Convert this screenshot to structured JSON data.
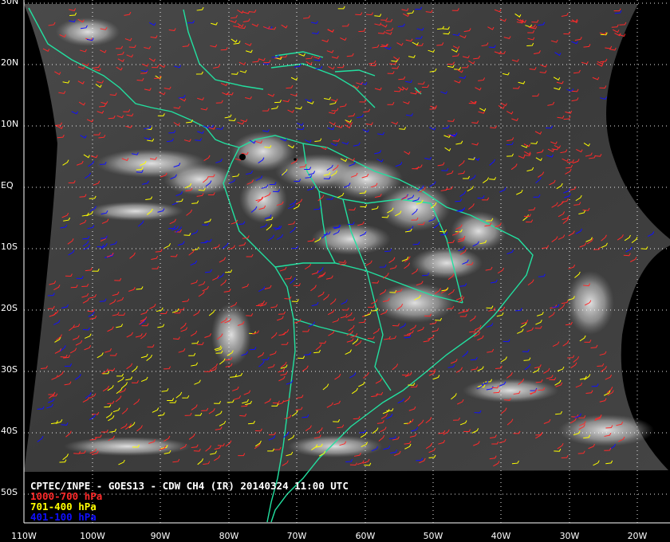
{
  "product_title": "CPTEC/INPE - GOES13 - CDW CH4 (IR) 20140324 11:00 UTC",
  "latitude_labels": [
    "30N",
    "20N",
    "10N",
    "EQ",
    "10S",
    "20S",
    "30S",
    "40S",
    "50S"
  ],
  "longitude_labels": [
    "110W",
    "100W",
    "90W",
    "80W",
    "70W",
    "60W",
    "50W",
    "40W",
    "30W",
    "20W"
  ],
  "legend": [
    {
      "label": "1000-700 hPa",
      "color": "#ff2a2a"
    },
    {
      "label": "701-400 hPa",
      "color": "#ffff00"
    },
    {
      "label": "401-100 hPa",
      "color": "#1010ff"
    }
  ],
  "colors": {
    "background": "#000000",
    "coastline": "#22e0a0",
    "grid": "#ffffff",
    "marker": "#000000"
  }
}
